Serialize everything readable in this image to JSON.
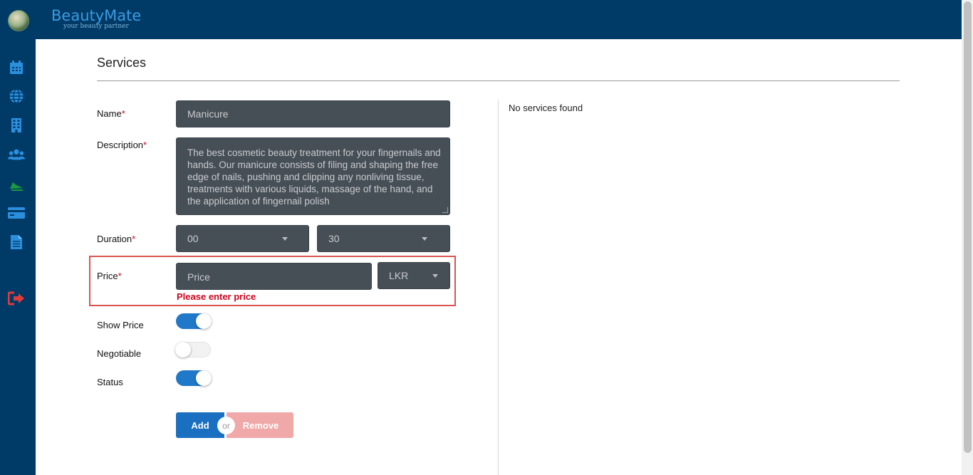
{
  "app": {
    "brand_name": "BeautyMate",
    "brand_tagline": "your beauty partner",
    "colors": {
      "header": "#003a66",
      "accent": "#1f78c8",
      "error": "#d0021b",
      "input_bg": "#464e56",
      "remove_btn": "#f0a8a8"
    }
  },
  "sidebar": {
    "items": [
      {
        "icon": "calendar-icon"
      },
      {
        "icon": "globe-icon"
      },
      {
        "icon": "building-icon"
      },
      {
        "icon": "users-icon"
      },
      {
        "icon": "chart-icon"
      },
      {
        "icon": "credit-card-icon"
      },
      {
        "icon": "document-icon"
      },
      {
        "icon": "logout-icon"
      }
    ]
  },
  "page": {
    "title": "Services"
  },
  "form": {
    "name": {
      "label": "Name",
      "required": "*",
      "value": "Manicure"
    },
    "description": {
      "label": "Description",
      "required": "*",
      "value": "The best cosmetic beauty treatment for your fingernails and hands. Our manicure consists of filing and shaping the free edge of nails, pushing and clipping any nonliving tissue, treatments with various liquids, massage of the hand, and the application of fingernail polish"
    },
    "duration": {
      "label": "Duration",
      "required": "*",
      "hours": "00",
      "minutes": "30"
    },
    "price": {
      "label": "Price",
      "required": "*",
      "placeholder": "Price",
      "currency": "LKR",
      "error": "Please enter price"
    },
    "show_price": {
      "label": "Show Price",
      "on": true
    },
    "negotiable": {
      "label": "Negotiable",
      "on": false
    },
    "status": {
      "label": "Status",
      "on": true
    },
    "add_label": "Add",
    "or_label": "or",
    "remove_label": "Remove"
  },
  "services_list": {
    "empty_message": "No services found"
  }
}
